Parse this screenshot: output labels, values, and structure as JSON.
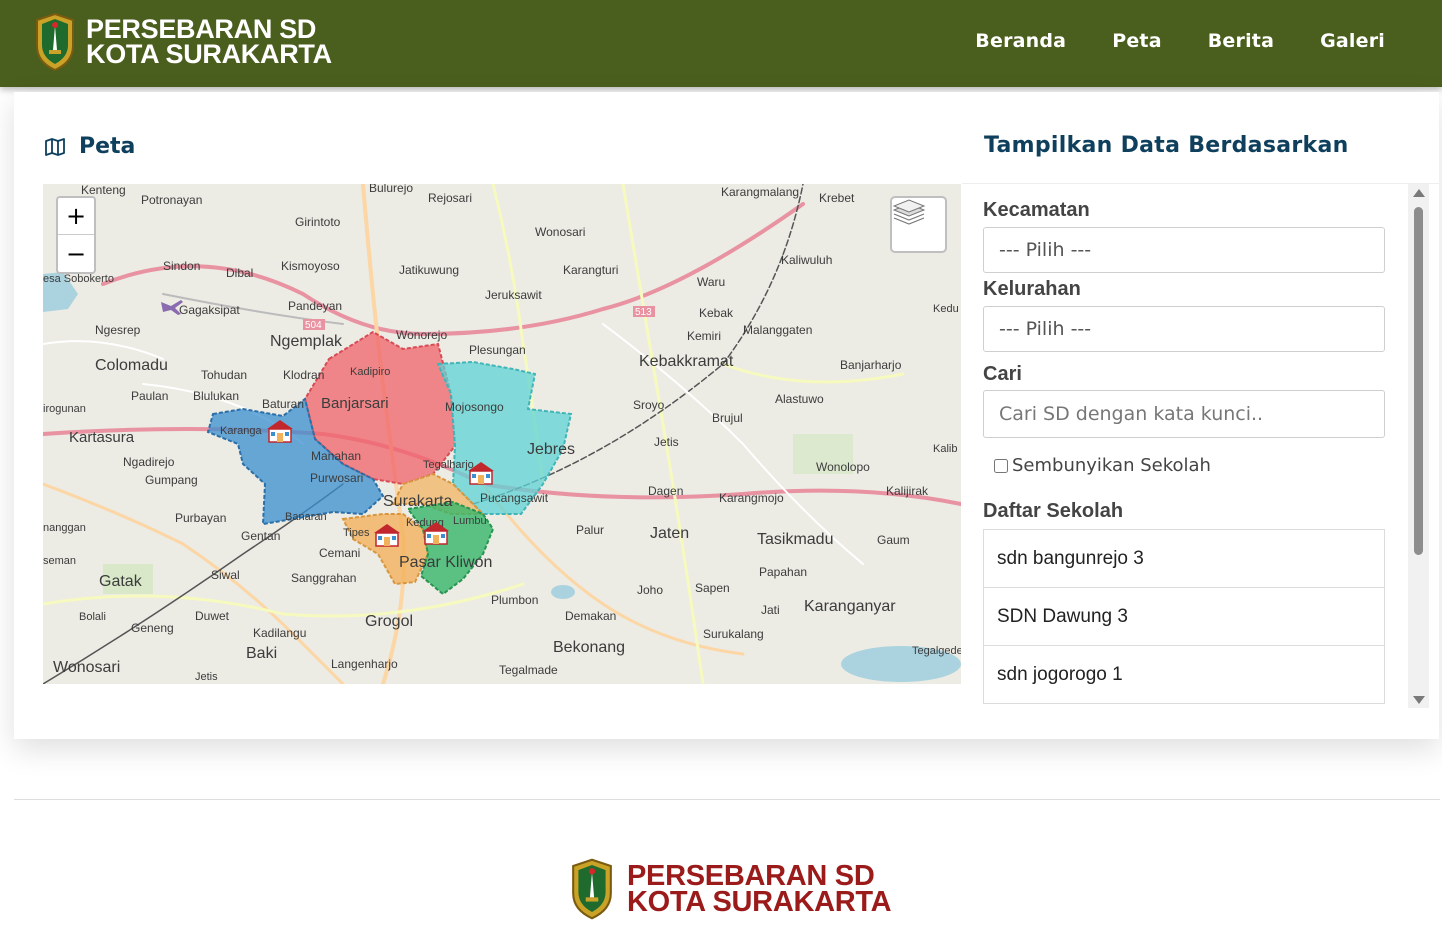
{
  "header": {
    "brand_line1": "PERSEBARAN SD",
    "brand_line2": "KOTA SURAKARTA",
    "nav": [
      "Beranda",
      "Peta",
      "Berita",
      "Galeri"
    ]
  },
  "map_section": {
    "title": "Peta",
    "zoom_in": "+",
    "zoom_out": "−",
    "place_labels": [
      "Kenteng",
      "Potronayan",
      "Bulurejo",
      "Rejosari",
      "Girintoto",
      "Karangmalang",
      "Krebet",
      "Sindon",
      "Dibal",
      "Kismoyoso",
      "Jatikuwung",
      "Wonosari",
      "Karangturi",
      "Kaliwuluh",
      "esa Sobokerto",
      "Gagaksipat",
      "Pandeyan",
      "Jeruksawit",
      "Waru",
      "Ngesrep",
      "Ngemplak",
      "Wonorejo",
      "Kebak",
      "Kemiri",
      "Malanggaten",
      "Colomadu",
      "Tohudan",
      "Klodran",
      "Plesungan",
      "Kebakkramat",
      "Banjarharjo",
      "Paulan",
      "Blulukan",
      "Baturan",
      "Kadipiro",
      "Banjarsari",
      "Mojosongo",
      "Sroyo",
      "Brujul",
      "Alastuwo",
      "Kartasura",
      "Karanga",
      "Jebres",
      "Jetis",
      "Ngadirejo",
      "Gumpang",
      "Manahan",
      "Purwosari",
      "Tegalharjo",
      "Pucangsawit",
      "Wonolopo",
      "Kalijirak",
      "Purbayan",
      "Banaran",
      "Surakarta",
      "Dagen",
      "Karangmojo",
      "Gentan",
      "Cemani",
      "Tipes",
      "Kedung",
      "Lumbu",
      "Palur",
      "Jaten",
      "Tasikmadu",
      "Gaum",
      "Pasar Kliwon",
      "Siwal",
      "Sanggrahan",
      "Papahan",
      "Gatak",
      "Duwet",
      "Joho",
      "Sapen",
      "Plumbon",
      "Demakan",
      "Jati",
      "Karanganyar",
      "Geneng",
      "Kadilangu",
      "Grogol",
      "Surukalang",
      "Baki",
      "Bekonang",
      "Tegalgede",
      "Wonosari",
      "Langenharjo",
      "Tegalmade",
      "Jetis",
      "nanggan",
      "seman",
      "Bolali",
      "irogunan",
      "Kalib",
      "Kedu"
    ],
    "road_labels": [
      "504",
      "513"
    ]
  },
  "side_panel": {
    "title": "Tampilkan Data Berdasarkan",
    "kecamatan_label": "Kecamatan",
    "kecamatan_value": "--- Pilih ---",
    "kelurahan_label": "Kelurahan",
    "kelurahan_value": "--- Pilih ---",
    "search_label": "Cari",
    "search_placeholder": "Cari SD dengan kata kunci..",
    "hide_schools_label": "Sembunyikan Sekolah",
    "school_list_label": "Daftar Sekolah",
    "schools": [
      "sdn bangunrejo 3",
      "SDN Dawung 3",
      "sdn jogorogo 1"
    ]
  },
  "footer": {
    "brand_line1": "PERSEBARAN SD",
    "brand_line2": "KOTA SURAKARTA"
  },
  "colors": {
    "header_bg": "#4a5e1d",
    "title_blue": "#0e3f5c",
    "footer_brand": "#9b1b1b",
    "district_red": "#f0636a",
    "district_cyan": "#5fd3d6",
    "district_blue": "#3a8fd0",
    "district_green": "#36b66a",
    "district_orange": "#f2b25c"
  }
}
